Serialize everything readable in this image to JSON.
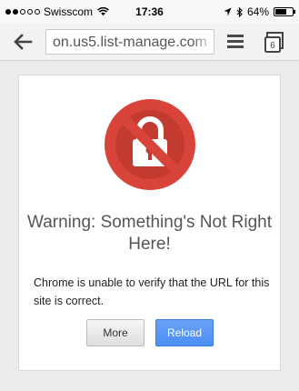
{
  "status_bar": {
    "carrier": "Swisscom",
    "time": "17:36",
    "battery": "64%",
    "signal_bars_filled": 2,
    "signal_bars_total": 5,
    "battery_level": 0.64
  },
  "toolbar": {
    "url": "on.us5.list-manage.com",
    "tab_count": "6"
  },
  "warning": {
    "title": "Warning: Something's Not Right Here!",
    "message": "Chrome is unable to verify that the URL for this site is correct.",
    "more_label": "More",
    "reload_label": "Reload"
  },
  "colors": {
    "accent": "#4d8ef2",
    "danger": "#d9443a"
  }
}
